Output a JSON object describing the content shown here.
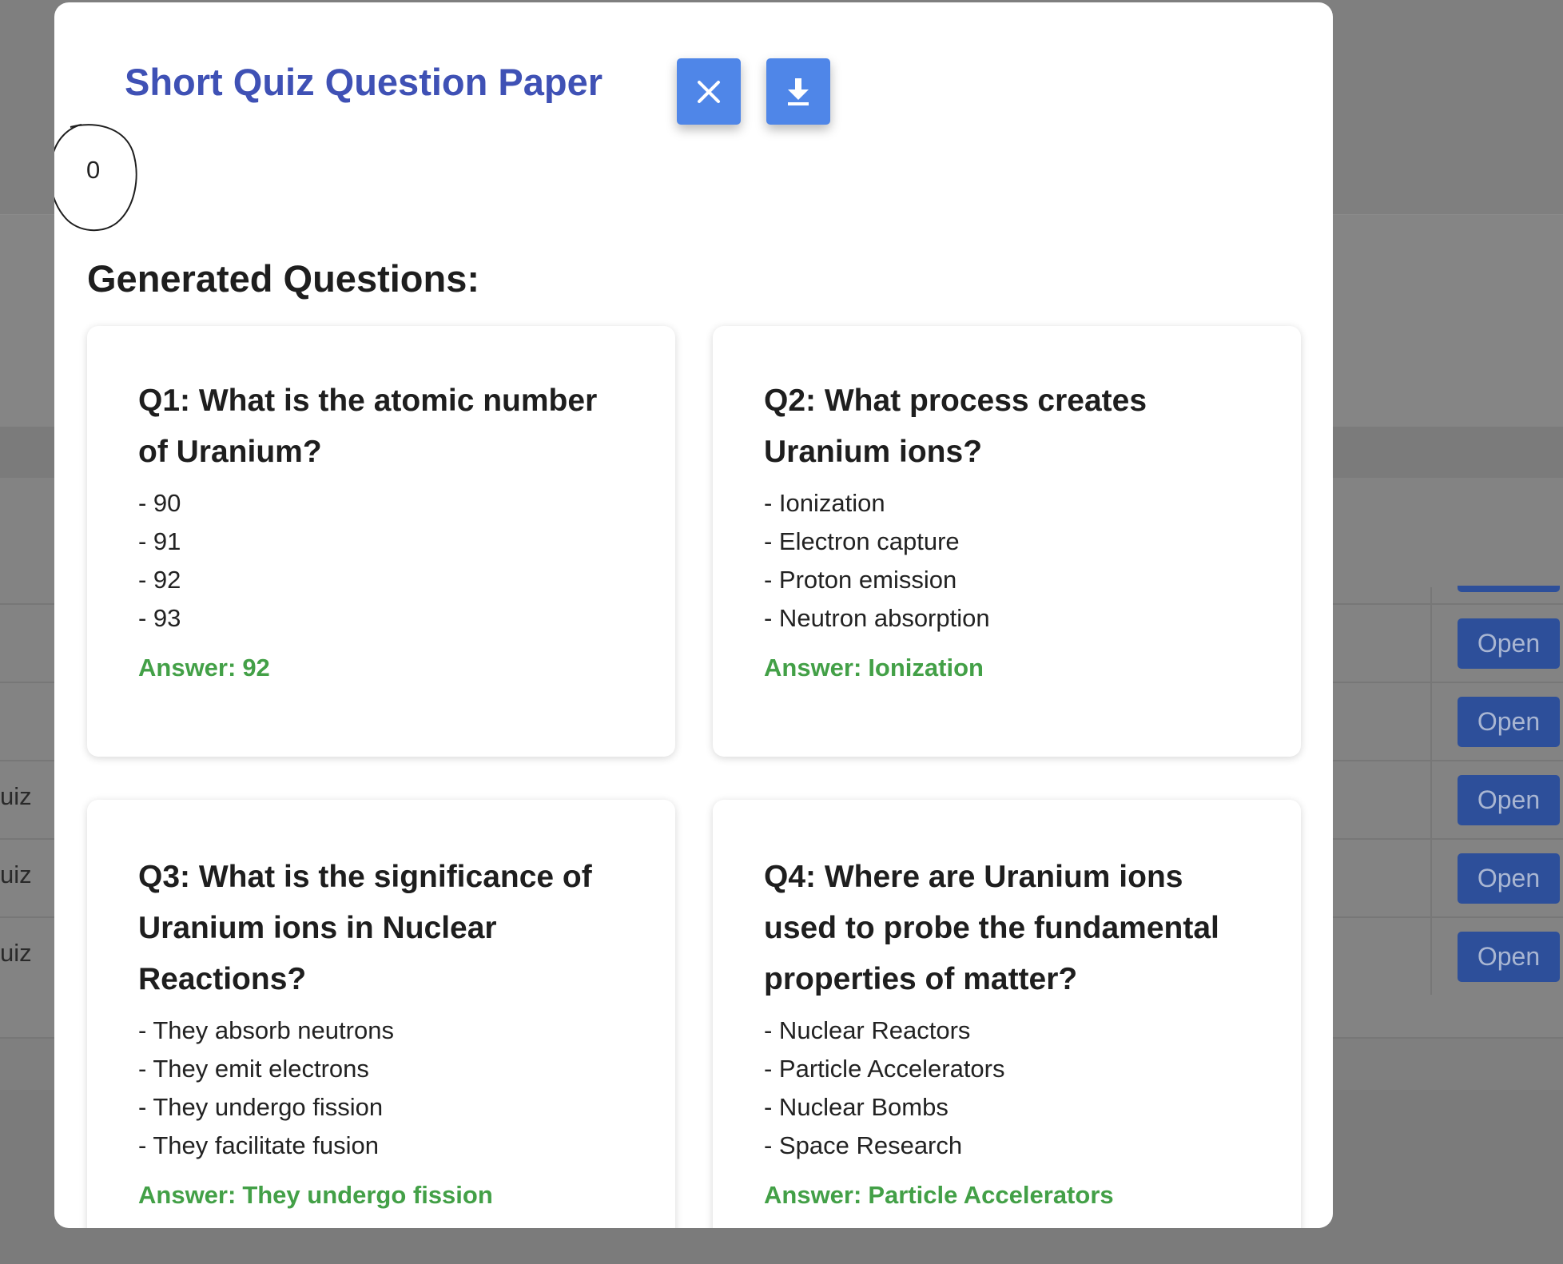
{
  "background": {
    "row_labels": [
      "uiz",
      "uiz",
      "uiz"
    ],
    "open_buttons": [
      "Open",
      "Open",
      "Open",
      "Open",
      "Open"
    ]
  },
  "modal": {
    "title": "Short Quiz Question Paper",
    "close_icon": "close-icon",
    "download_icon": "download-icon",
    "counter_value": "0",
    "section_heading": "Generated Questions:",
    "answer_prefix": "Answer:",
    "questions": [
      {
        "question": "Q1: What is the atomic number of Uranium?",
        "options": [
          "- 90",
          "- 91",
          "- 92",
          "- 93"
        ],
        "answer": "92"
      },
      {
        "question": "Q2: What process creates Uranium ions?",
        "options": [
          "- Ionization",
          "- Electron capture",
          "- Proton emission",
          "- Neutron absorption"
        ],
        "answer": "Ionization"
      },
      {
        "question": "Q3: What is the significance of Uranium ions in Nuclear Reactions?",
        "options": [
          "- They absorb neutrons",
          "- They emit electrons",
          "- They undergo fission",
          "- They facilitate fusion"
        ],
        "answer": "They undergo fission"
      },
      {
        "question": "Q4: Where are Uranium ions used to probe the fundamental properties of matter?",
        "options": [
          "- Nuclear Reactors",
          "- Particle Accelerators",
          "- Nuclear Bombs",
          "- Space Research"
        ],
        "answer": "Particle Accelerators"
      }
    ]
  },
  "colors": {
    "title": "#3f51b5",
    "button": "#4f86e8",
    "answer": "#43a047",
    "overlay": "#7b7b7b",
    "open_button": "#2d4f9a"
  }
}
